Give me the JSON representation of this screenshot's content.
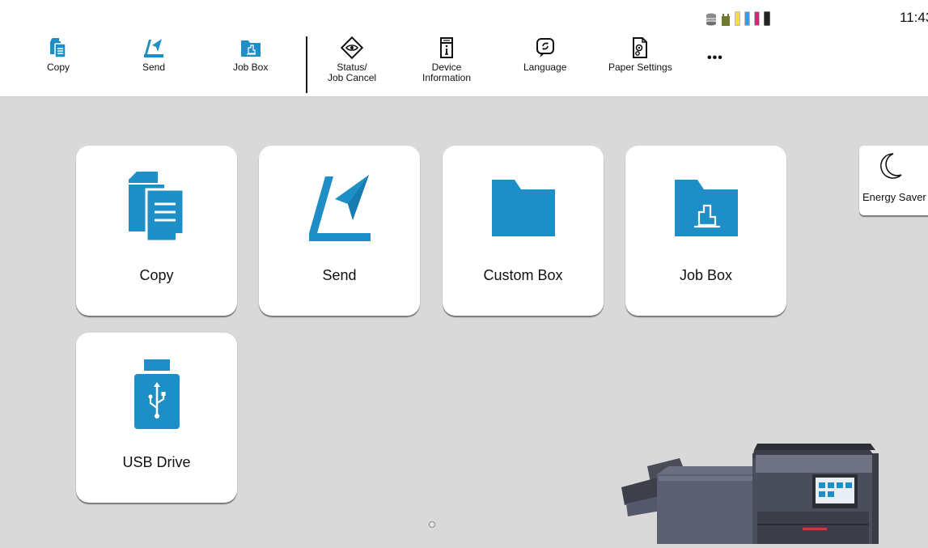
{
  "status_bar": {
    "time": "11:43",
    "icons": [
      "storage-icon",
      "waste-toner-icon",
      "toner-yellow-icon",
      "toner-cyan-icon",
      "toner-magenta-icon",
      "toner-black-icon"
    ]
  },
  "toolbar": {
    "items": [
      {
        "label": "Copy",
        "icon": "copy-icon"
      },
      {
        "label": "Send",
        "icon": "send-icon"
      },
      {
        "label": "Job Box",
        "icon": "job-box-icon"
      },
      {
        "label_line1": "Status/",
        "label_line2": "Job Cancel",
        "icon": "eye-icon"
      },
      {
        "label_line1": "Device",
        "label_line2": "Information",
        "icon": "device-info-icon"
      },
      {
        "label": "Language",
        "icon": "language-icon"
      },
      {
        "label": "Paper Settings",
        "icon": "paper-settings-icon"
      }
    ],
    "more_label": "•••"
  },
  "tiles": [
    {
      "label": "Copy",
      "icon": "copy-icon"
    },
    {
      "label": "Send",
      "icon": "send-icon"
    },
    {
      "label": "Custom Box",
      "icon": "folder-icon"
    },
    {
      "label": "Job Box",
      "icon": "job-box-icon"
    },
    {
      "label": "USB Drive",
      "icon": "usb-drive-icon"
    }
  ],
  "energy_saver": {
    "label": "Energy Saver",
    "icon": "moon-icon"
  },
  "colors": {
    "accent": "#1e8fc6",
    "background": "#d9d9d9",
    "tile": "#ffffff"
  }
}
